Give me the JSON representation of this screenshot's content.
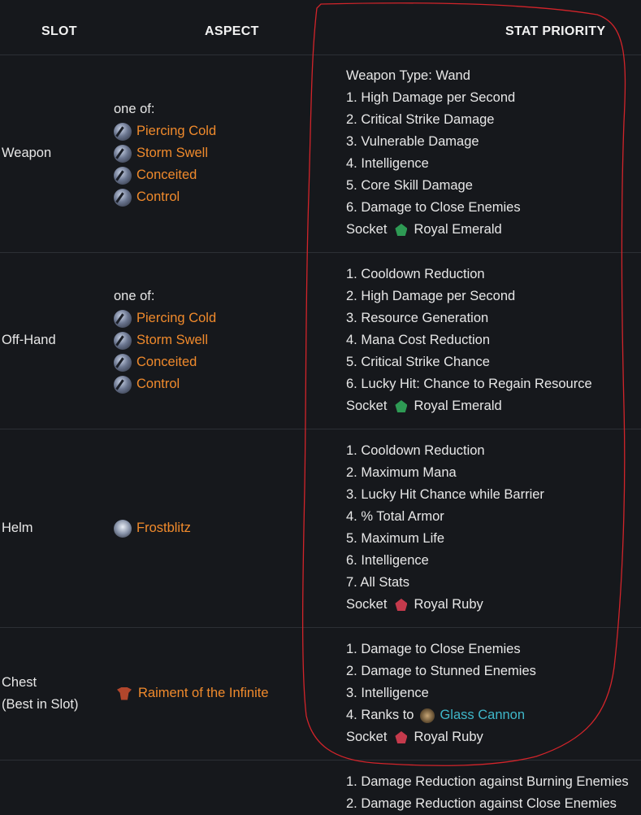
{
  "header": {
    "slot": "SLOT",
    "aspect": "ASPECT",
    "stat_priority": "STAT PRIORITY"
  },
  "rows": [
    {
      "slot": [
        "Weapon"
      ],
      "one_of": "one of:",
      "aspects": [
        "Piercing Cold",
        "Storm Swell",
        "Conceited",
        "Control"
      ],
      "stats": [
        "Weapon Type: Wand",
        "1. High Damage per Second",
        "2. Critical Strike Damage",
        "3. Vulnerable Damage",
        "4. Intelligence",
        "5. Core Skill Damage",
        "6. Damage to Close Enemies"
      ],
      "socket_label": "Socket",
      "socket_gem": "Royal Emerald"
    },
    {
      "slot": [
        "Off-Hand"
      ],
      "one_of": "one of:",
      "aspects": [
        "Piercing Cold",
        "Storm Swell",
        "Conceited",
        "Control"
      ],
      "stats": [
        "1. Cooldown Reduction",
        "2. High Damage per Second",
        "3. Resource Generation",
        "4. Mana Cost Reduction",
        "5. Critical Strike Chance",
        "6. Lucky Hit: Chance to Regain Resource"
      ],
      "socket_label": "Socket",
      "socket_gem": "Royal Emerald"
    },
    {
      "slot": [
        "Helm"
      ],
      "aspects": [
        "Frostblitz"
      ],
      "stats": [
        "1. Cooldown Reduction",
        "2. Maximum Mana",
        "3. Lucky Hit Chance while Barrier",
        "4. % Total Armor",
        "5. Maximum Life",
        "6. Intelligence",
        "7. All Stats"
      ],
      "socket_label": "Socket",
      "socket_gem": "Royal Ruby"
    },
    {
      "slot": [
        "Chest",
        "(Best in Slot)"
      ],
      "aspects": [
        "Raiment of the Infinite"
      ],
      "stats": [
        "1. Damage to Close Enemies",
        "2. Damage to Stunned Enemies",
        "3. Intelligence"
      ],
      "ranks_prefix": "4. Ranks to",
      "ranks_skill": "Glass Cannon",
      "socket_label": "Socket",
      "socket_gem": "Royal Ruby"
    },
    {
      "stats": [
        "1. Damage Reduction against Burning Enemies",
        "2. Damage Reduction against Close Enemies"
      ]
    }
  ],
  "colors": {
    "background": "#16181c",
    "aspect": "#f08a2c",
    "skill": "#3fb7c9",
    "annotation": "#d2242a",
    "emerald": "#2e9a54",
    "ruby": "#c53a4c"
  }
}
